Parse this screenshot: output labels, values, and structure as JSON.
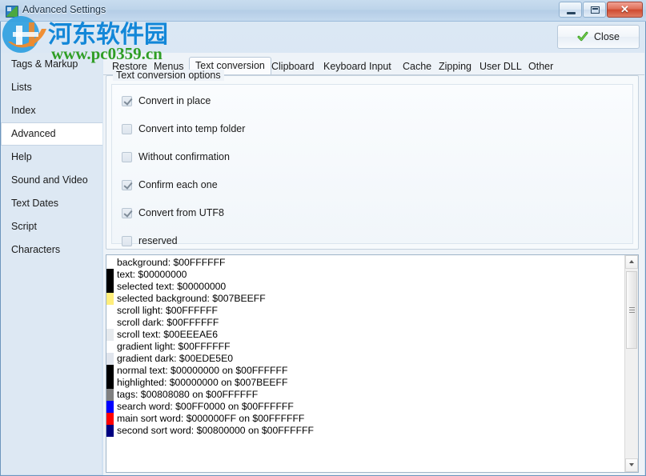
{
  "window": {
    "title": "Advanced Settings",
    "icon": "app-icon",
    "buttons": {
      "minimize": "minimize-icon",
      "maximize": "maximize-icon",
      "close": "close-icon"
    }
  },
  "watermark": {
    "cn_text": "河东软件园",
    "url": "www.pc0359.cn"
  },
  "toolbar": {
    "close_label": "Close",
    "close_icon": "green-check-icon"
  },
  "sidebar": {
    "items": [
      {
        "label": "Tags & Markup",
        "selected": false
      },
      {
        "label": "Lists",
        "selected": false
      },
      {
        "label": "Index",
        "selected": false
      },
      {
        "label": "Advanced",
        "selected": true
      },
      {
        "label": "Help",
        "selected": false
      },
      {
        "label": "Sound and Video",
        "selected": false
      },
      {
        "label": "Text Dates",
        "selected": false
      },
      {
        "label": "Script",
        "selected": false
      },
      {
        "label": "Characters",
        "selected": false
      }
    ]
  },
  "tabs": [
    {
      "label": "Restore",
      "active": false
    },
    {
      "label": "Menus",
      "active": false
    },
    {
      "label": "Text conversion",
      "active": true
    },
    {
      "label": "Clipboard",
      "active": false
    },
    {
      "label": "Keyboard Input",
      "active": false
    },
    {
      "label": "Cache",
      "active": false
    },
    {
      "label": "Zipping",
      "active": false
    },
    {
      "label": "User DLL",
      "active": false
    },
    {
      "label": "Other",
      "active": false
    }
  ],
  "groupbox": {
    "title": "Text conversion options",
    "checkboxes": [
      {
        "label": "Convert in place",
        "checked": true
      },
      {
        "label": "Convert into temp folder",
        "checked": false
      },
      {
        "label": "Without confirmation",
        "checked": false
      },
      {
        "label": "Confirm each one",
        "checked": true
      },
      {
        "label": "Convert from UTF8",
        "checked": true
      },
      {
        "label": "reserved",
        "checked": false
      }
    ]
  },
  "colorlist": {
    "rows": [
      {
        "text": "background: $00FFFFFF",
        "swatch": "#ffffff"
      },
      {
        "text": "text: $00000000",
        "swatch": "#000000"
      },
      {
        "text": "selected text: $00000000",
        "swatch": "#000000"
      },
      {
        "text": "selected background: $007BEEFF",
        "swatch": "#ffee7b"
      },
      {
        "text": "scroll light: $00FFFFFF",
        "swatch": "#ffffff"
      },
      {
        "text": "scroll dark: $00FFFFFF",
        "swatch": "#ffffff"
      },
      {
        "text": "scroll text: $00EEEAE6",
        "swatch": "#e6eaee"
      },
      {
        "text": "gradient light: $00FFFFFF",
        "swatch": "#ffffff"
      },
      {
        "text": "gradient dark: $00EDE5E0",
        "swatch": "#e0e5ed"
      },
      {
        "text": "normal text: $00000000 on $00FFFFFF",
        "swatch": "#000000"
      },
      {
        "text": "highlighted: $00000000 on $007BEEFF",
        "swatch": "#000000"
      },
      {
        "text": "tags: $00808080 on $00FFFFFF",
        "swatch": "#808080"
      },
      {
        "text": "search word: $00FF0000 on $00FFFFFF",
        "swatch": "#0000ff"
      },
      {
        "text": "main sort word: $000000FF on $00FFFFFF",
        "swatch": "#ff0000"
      },
      {
        "text": "second sort word: $00800000 on $00FFFFFF",
        "swatch": "#000080"
      }
    ]
  },
  "scrollbar": {
    "up_icon": "scroll-up-arrow-icon",
    "down_icon": "scroll-down-arrow-icon"
  }
}
